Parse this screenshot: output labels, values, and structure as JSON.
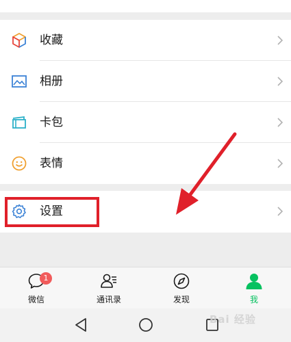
{
  "menu": {
    "items": [
      {
        "label": "收藏",
        "icon": "favorites-cube-icon"
      },
      {
        "label": "相册",
        "icon": "album-picture-icon"
      },
      {
        "label": "卡包",
        "icon": "card-wallet-icon"
      },
      {
        "label": "表情",
        "icon": "sticker-smile-icon"
      }
    ],
    "settings": {
      "label": "设置",
      "icon": "gear-icon"
    }
  },
  "tabbar": {
    "tabs": [
      {
        "label": "微信",
        "icon": "chat-bubble-icon",
        "badge": "1"
      },
      {
        "label": "通讯录",
        "icon": "contacts-icon"
      },
      {
        "label": "发现",
        "icon": "compass-icon"
      },
      {
        "label": "我",
        "icon": "person-icon",
        "active": true
      }
    ]
  },
  "watermark": {
    "text": "Bai 经验"
  },
  "colors": {
    "accent_green": "#07c160",
    "highlight_red": "#e0202a",
    "badge_red": "#f15b5b",
    "background": "#ededed"
  }
}
